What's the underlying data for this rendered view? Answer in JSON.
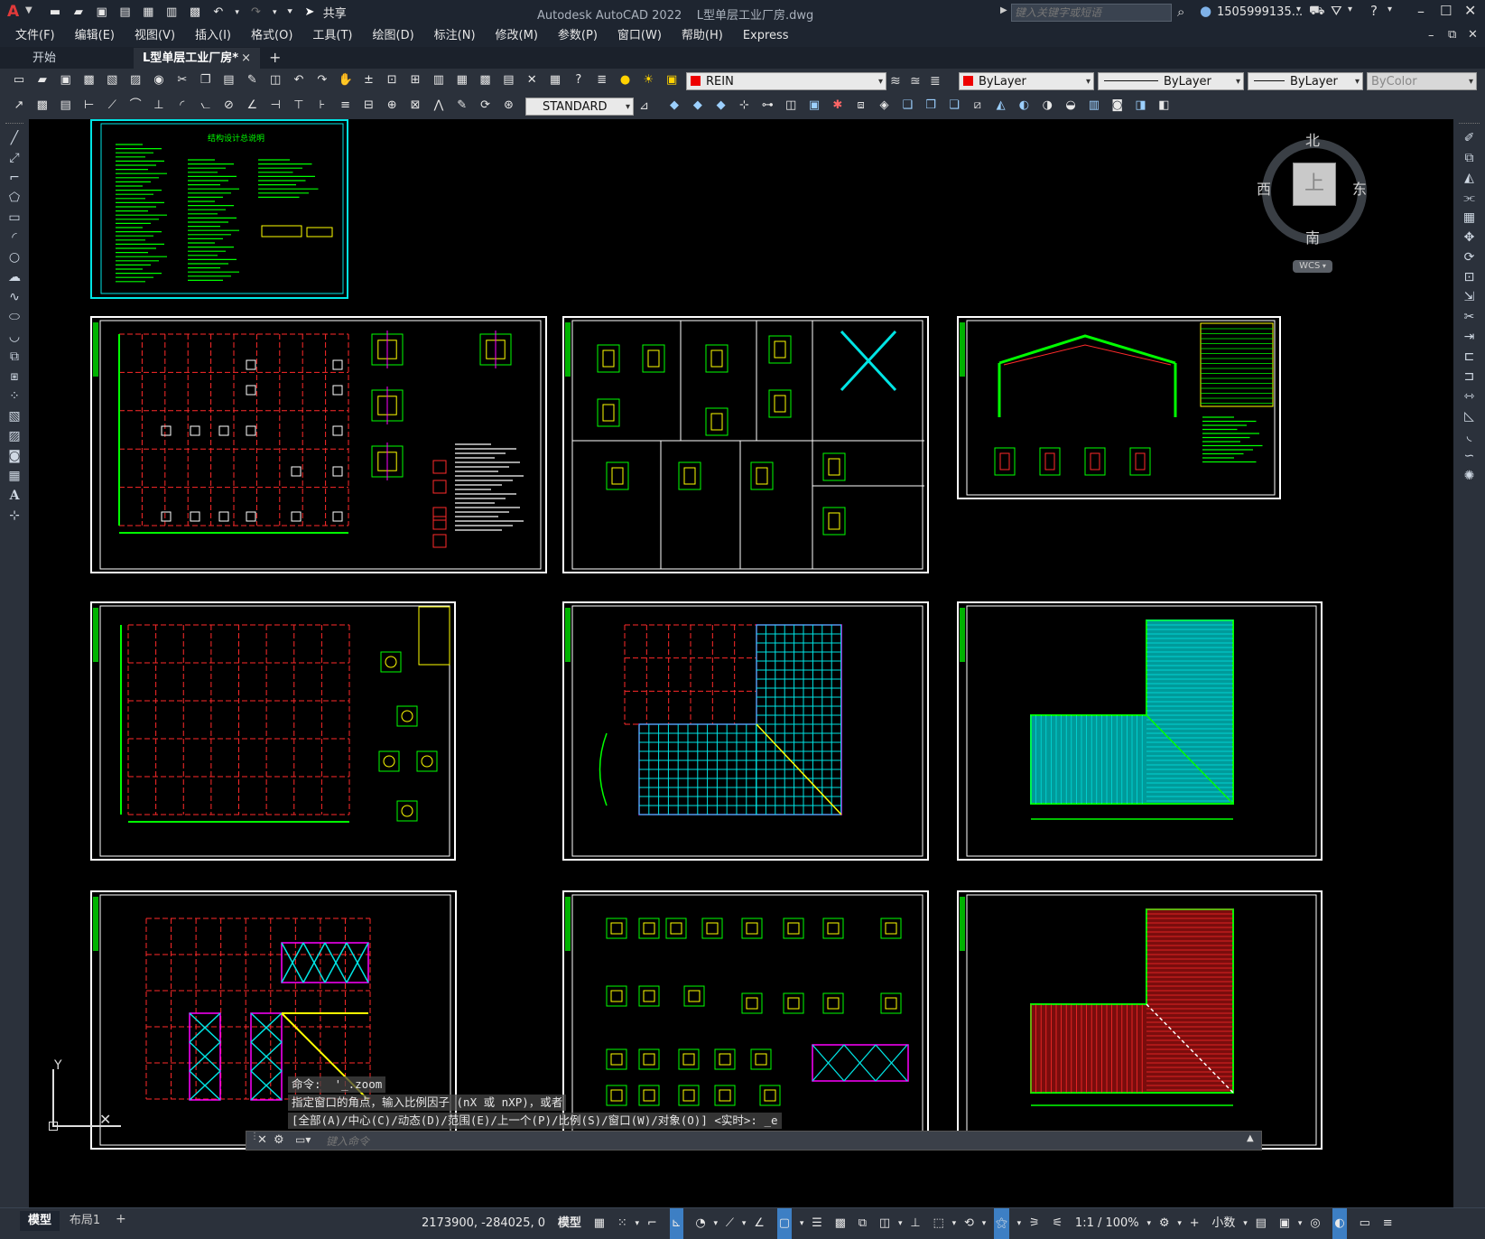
{
  "app": {
    "title": "Autodesk AutoCAD 2022",
    "filename": "L型单层工业厂房.dwg",
    "share_label": "共享",
    "search_placeholder": "键入关键字或短语",
    "user": "1505999135...",
    "logo": "A"
  },
  "menu": [
    "文件(F)",
    "编辑(E)",
    "视图(V)",
    "插入(I)",
    "格式(O)",
    "工具(T)",
    "绘图(D)",
    "标注(N)",
    "修改(M)",
    "参数(P)",
    "窗口(W)",
    "帮助(H)",
    "Express"
  ],
  "doc_tabs": {
    "start": "开始",
    "active": "L型单层工业厂房*",
    "close": "×",
    "add": "+"
  },
  "toolbar": {
    "layer_name": "REIN",
    "color_value": "ByLayer",
    "linetype_value": "ByLayer",
    "lineweight_value": "ByLayer",
    "plotstyle_value": "ByColor",
    "textstyle_value": "STANDARD"
  },
  "viewcube": {
    "north": "北",
    "south": "南",
    "east": "东",
    "west": "西",
    "face": "上",
    "wcs": "WCS"
  },
  "drawing": {
    "sheet1_title": "结构设计总说明",
    "ucs_y": "Y"
  },
  "command": {
    "history": [
      "命令:  '_.zoom",
      "指定窗口的角点，输入比例因子 (nX 或 nXP)，或者",
      "[全部(A)/中心(C)/动态(D)/范围(E)/上一个(P)/比例(S)/窗口(W)/对象(O)] <实时>: _e"
    ],
    "placeholder": "键入命令"
  },
  "status": {
    "layout_tabs": [
      "模型",
      "布局1"
    ],
    "add_layout": "+",
    "coords": "2173900, -284025, 0",
    "model_label": "模型",
    "scale": "1:1 / 100%",
    "units": "小数"
  },
  "colors": {
    "grid_red": "#ff2a2a",
    "line_green": "#00ff00",
    "cyan": "#00e5e5",
    "yellow": "#ffff00",
    "magenta": "#ff00ff",
    "ui_dark": "#2b313b"
  }
}
